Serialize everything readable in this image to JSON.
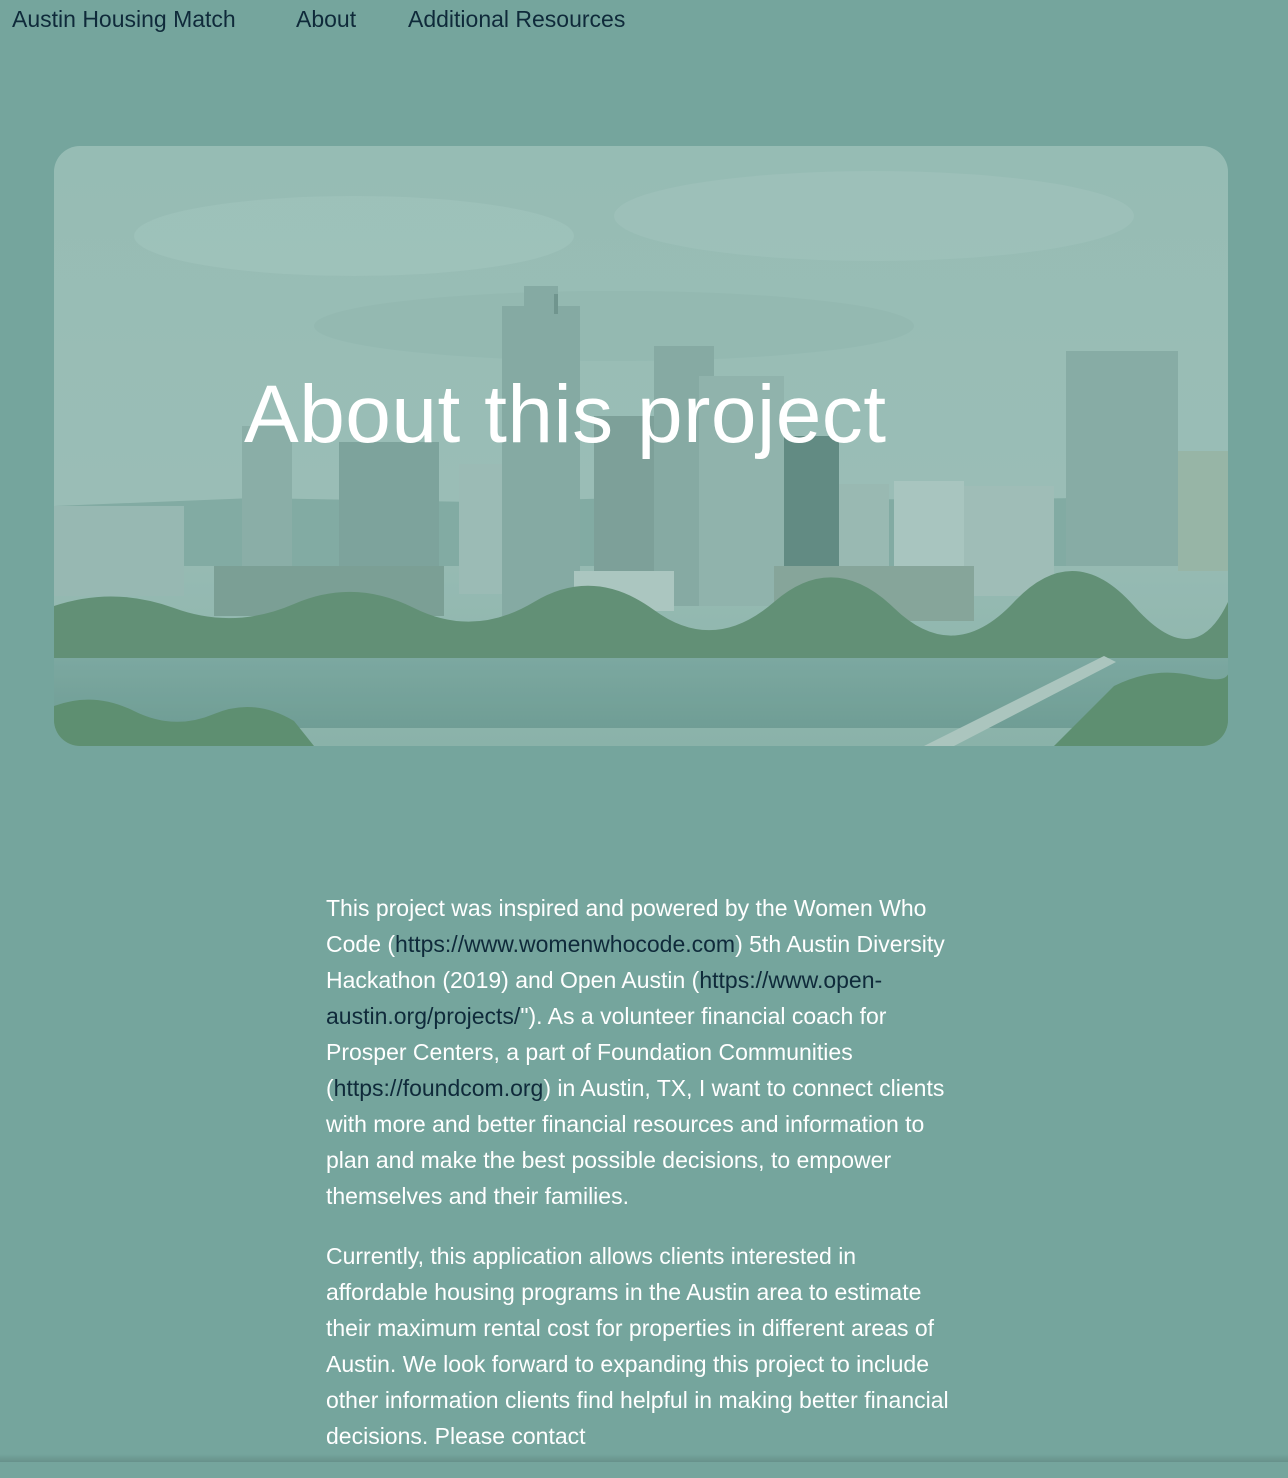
{
  "nav": {
    "brand": "Austin Housing Match",
    "about": "About",
    "resources": "Additional Resources"
  },
  "hero": {
    "title": "About this project"
  },
  "content": {
    "p1": {
      "t1": "This project was inspired and powered by the Women Who Code (",
      "link1": "https://www.womenwhocode.com",
      "t2": ") 5th Austin Diversity Hackathon (2019) and Open Austin (",
      "link2": "https://www.open-austin.org/projects/",
      "t3": "\"). As a volunteer financial coach for Prosper Centers, a part of Foundation Communities (",
      "link3": "https://foundcom.org",
      "t4": ") in Austin, TX, I want to connect clients with more and better financial resources and information to plan and make the best possible decisions, to empower themselves and their families."
    },
    "p2": "Currently, this application allows clients interested in affordable housing programs in the Austin area to estimate their maximum rental cost for properties in different areas of Austin. We look forward to expanding this project to include other information clients find helpful in making better financial decisions. Please contact"
  },
  "colors": {
    "background": "#75a59d",
    "nav_text": "#0f2a3a",
    "body_text": "#ffffff",
    "link_text": "#0f2a3a"
  }
}
